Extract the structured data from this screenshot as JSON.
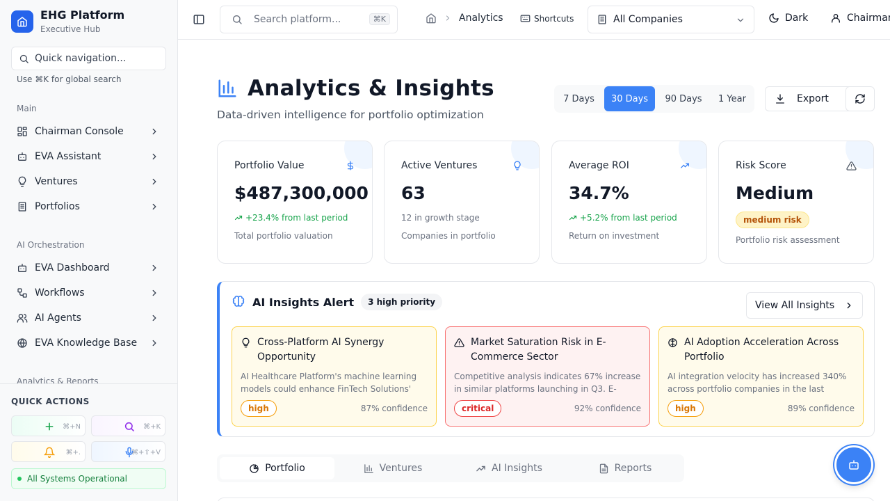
{
  "brand": {
    "title": "EHG Platform",
    "subtitle": "Executive Hub"
  },
  "sidebar": {
    "quick_nav_placeholder": "Quick navigation...",
    "hint": "Use ⌘K for global search",
    "sections": [
      {
        "label": "Main",
        "items": [
          {
            "label": "Chairman Console",
            "icon": "layout-grid-icon"
          },
          {
            "label": "EVA Assistant",
            "icon": "bot-icon"
          },
          {
            "label": "Ventures",
            "icon": "lightbulb-icon"
          },
          {
            "label": "Portfolios",
            "icon": "building-icon"
          }
        ]
      },
      {
        "label": "AI Orchestration",
        "items": [
          {
            "label": "EVA Dashboard",
            "icon": "bot-icon"
          },
          {
            "label": "Workflows",
            "icon": "workflow-icon"
          },
          {
            "label": "AI Agents",
            "icon": "users-icon"
          },
          {
            "label": "EVA Knowledge Base",
            "icon": "globe-icon"
          }
        ]
      },
      {
        "label": "Analytics & Reports"
      }
    ],
    "quick_actions": {
      "title": "QUICK ACTIONS",
      "buttons": [
        {
          "icon": "plus-icon",
          "shortcut": "⌘+N",
          "color": "#16a34a"
        },
        {
          "icon": "search-icon",
          "shortcut": "⌘+K",
          "color": "#9333ea"
        },
        {
          "icon": "bell-icon",
          "shortcut": "⌘+.",
          "color": "#f59e0b"
        },
        {
          "icon": "mic-icon",
          "shortcut": "⌘+⇧+V",
          "color": "#3b82f6"
        }
      ]
    },
    "status": "All Systems Operational"
  },
  "topbar": {
    "search_placeholder": "Search platform...",
    "search_kbd": "⌘K",
    "breadcrumb_current": "Analytics",
    "shortcuts_label": "Shortcuts",
    "company_selected": "All Companies",
    "theme_label": "Dark",
    "user_label": "Chairman"
  },
  "page": {
    "title": "Analytics & Insights",
    "subtitle": "Data-driven intelligence for portfolio optimization",
    "ranges": [
      "7 Days",
      "30 Days",
      "90 Days",
      "1 Year"
    ],
    "active_range": "30 Days",
    "export_label": "Export"
  },
  "kpis": [
    {
      "label": "Portfolio Value",
      "icon": "dollar-icon",
      "value": "$487,300,000",
      "trend": "+23.4% from last period",
      "desc": "Total portfolio valuation"
    },
    {
      "label": "Active Ventures",
      "icon": "lightbulb-icon",
      "value": "63",
      "note": "12 in growth stage",
      "desc": "Companies in portfolio"
    },
    {
      "label": "Average ROI",
      "icon": "trending-up-icon",
      "value": "34.7%",
      "trend": "+5.2% from last period",
      "desc": "Return on investment"
    },
    {
      "label": "Risk Score",
      "icon": "alert-triangle-icon",
      "value": "Medium",
      "badge": "medium risk",
      "desc": "Portfolio risk assessment"
    }
  ],
  "alert": {
    "title": "AI Insights Alert",
    "badge": "3 high priority",
    "view_all": "View All Insights",
    "insights": [
      {
        "title": "Cross-Platform AI Synergy Opportunity",
        "text": "AI Healthcare Platform's machine learning models could enhance FinTech Solutions' fraud detection capabilities",
        "severity": "high",
        "confidence": "87% confidence",
        "icon": "lightbulb-icon"
      },
      {
        "title": "Market Saturation Risk in E-Commerce Sector",
        "text": "Competitive analysis indicates 67% increase in similar platforms launching in Q3. E-Commerce ventures face pressure",
        "severity": "critical",
        "confidence": "92% confidence",
        "icon": "alert-triangle-icon"
      },
      {
        "title": "AI Adoption Acceleration Across Portfolio",
        "text": "AI integration velocity has increased 340% across portfolio companies in the last quarter",
        "severity": "high",
        "confidence": "89% confidence",
        "icon": "brain-icon"
      }
    ]
  },
  "tabs": [
    {
      "label": "Portfolio",
      "icon": "pie-chart-icon"
    },
    {
      "label": "Ventures",
      "icon": "bar-chart-icon"
    },
    {
      "label": "AI Insights",
      "icon": "trending-up-icon"
    },
    {
      "label": "Reports",
      "icon": "file-text-icon"
    }
  ],
  "colors": {
    "accent": "#3b82f6",
    "success": "#16a34a",
    "warning": "#f59e0b",
    "critical": "#dc2626"
  }
}
